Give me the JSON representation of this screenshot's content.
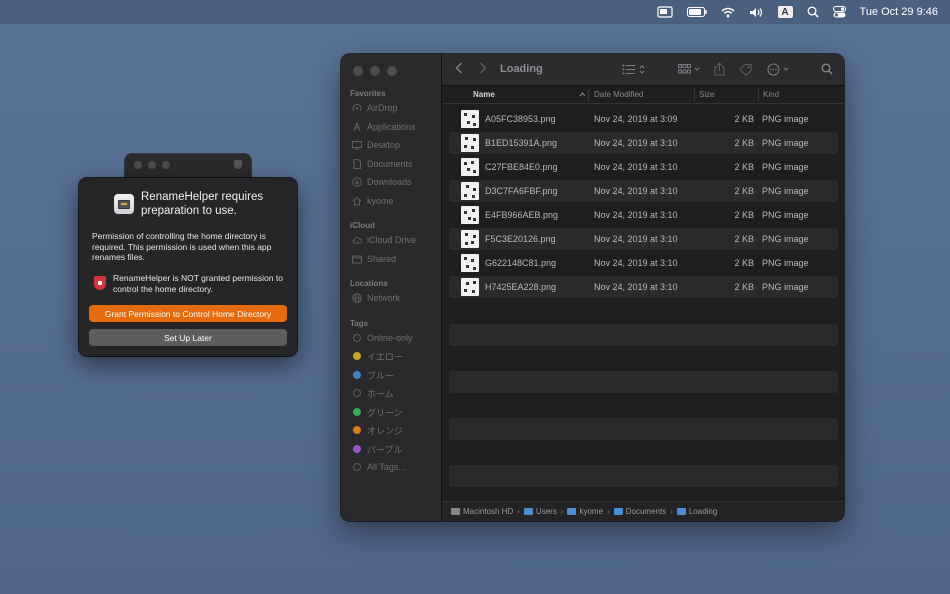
{
  "menubar": {
    "clock": "Tue Oct 29  9:46",
    "input_badge": "A"
  },
  "finder": {
    "title": "Loading",
    "sidebar": {
      "favorites_header": "Favorites",
      "favorites": [
        "AirDrop",
        "Applications",
        "Desktop",
        "Documents",
        "Downloads",
        "kyome"
      ],
      "icloud_header": "iCloud",
      "icloud": [
        "iCloud Drive",
        "Shared"
      ],
      "locations_header": "Locations",
      "locations": [
        "Network"
      ],
      "tags_header": "Tags",
      "tags": [
        {
          "label": "Online-only",
          "color": ""
        },
        {
          "label": "イエロー",
          "color": "#c9a227"
        },
        {
          "label": "ブルー",
          "color": "#3b82c4"
        },
        {
          "label": "ホーム",
          "color": ""
        },
        {
          "label": "グリーン",
          "color": "#3aa65a"
        },
        {
          "label": "オレンジ",
          "color": "#d97a1e"
        },
        {
          "label": "パープル",
          "color": "#9a55c9"
        },
        {
          "label": "All Tags...",
          "color": ""
        }
      ]
    },
    "columns": {
      "name": "Name",
      "date": "Date Modified",
      "size": "Size",
      "kind": "Kind"
    },
    "files": [
      {
        "name": "A05FC38953.png",
        "date": "Nov 24, 2019 at 3:09",
        "size": "2 KB",
        "kind": "PNG image"
      },
      {
        "name": "B1ED15391A.png",
        "date": "Nov 24, 2019 at 3:10",
        "size": "2 KB",
        "kind": "PNG image"
      },
      {
        "name": "C27FBE84E0.png",
        "date": "Nov 24, 2019 at 3:10",
        "size": "2 KB",
        "kind": "PNG image"
      },
      {
        "name": "D3C7FA6FBF.png",
        "date": "Nov 24, 2019 at 3:10",
        "size": "2 KB",
        "kind": "PNG image"
      },
      {
        "name": "E4FB966AEB.png",
        "date": "Nov 24, 2019 at 3:10",
        "size": "2 KB",
        "kind": "PNG image"
      },
      {
        "name": "F5C3E20126.png",
        "date": "Nov 24, 2019 at 3:10",
        "size": "2 KB",
        "kind": "PNG image"
      },
      {
        "name": "G622148C81.png",
        "date": "Nov 24, 2019 at 3:10",
        "size": "2 KB",
        "kind": "PNG image"
      },
      {
        "name": "H7425EA228.png",
        "date": "Nov 24, 2019 at 3:10",
        "size": "2 KB",
        "kind": "PNG image"
      }
    ],
    "path": [
      "Macintosh HD",
      "Users",
      "kyome",
      "Documents",
      "Loading"
    ]
  },
  "dialog": {
    "title": "RenameHelper requires preparation to use.",
    "body": "Permission of controlling the home directory is required. This permission is used when this app renames files.",
    "warning": "RenameHelper is NOT granted permission to control the home directory.",
    "primary_button": "Grant Permission to Control Home Directory",
    "secondary_button": "Set Up Later"
  }
}
